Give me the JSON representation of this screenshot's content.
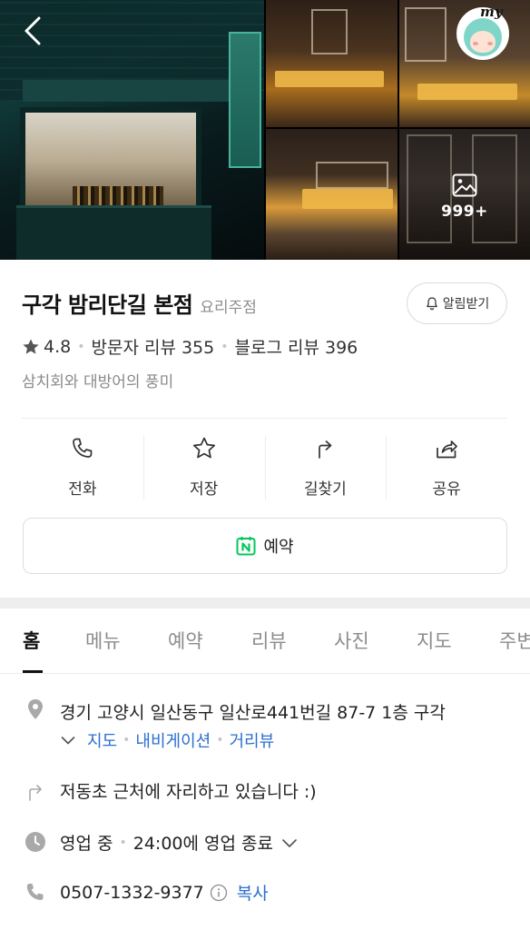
{
  "gallery": {
    "more_count": "999+",
    "avatar_label": "my"
  },
  "place": {
    "name": "구각 밤리단길 본점",
    "category": "요리주점",
    "notify_label": "알림받기",
    "rating": "4.8",
    "visitor_reviews": "방문자 리뷰 355",
    "blog_reviews": "블로그 리뷰 396",
    "tagline": "삼치회와 대방어의 풍미"
  },
  "actions": [
    {
      "label": "전화",
      "icon": "phone-icon"
    },
    {
      "label": "저장",
      "icon": "star-icon"
    },
    {
      "label": "길찾기",
      "icon": "directions-icon"
    },
    {
      "label": "공유",
      "icon": "share-icon"
    }
  ],
  "reserve": {
    "label": "예약",
    "icon": "naver-booking-icon"
  },
  "tabs": [
    {
      "label": "홈",
      "active": true
    },
    {
      "label": "메뉴"
    },
    {
      "label": "예약"
    },
    {
      "label": "리뷰"
    },
    {
      "label": "사진"
    },
    {
      "label": "지도"
    },
    {
      "label": "주변"
    }
  ],
  "info": {
    "address": "경기 고양시 일산동구 일산로441번길 87-7 1층 구각",
    "address_links": [
      "지도",
      "내비게이션",
      "거리뷰"
    ],
    "directions_note": "저동초 근처에 자리하고 있습니다 :)",
    "hours_status": "영업 중",
    "hours_detail": "24:00에 영업 종료",
    "phone": "0507-1332-9377",
    "copy_label": "복사"
  },
  "colors": {
    "link": "#2c6fd1",
    "naver_green": "#03c75a",
    "muted": "#8e8e8e"
  }
}
